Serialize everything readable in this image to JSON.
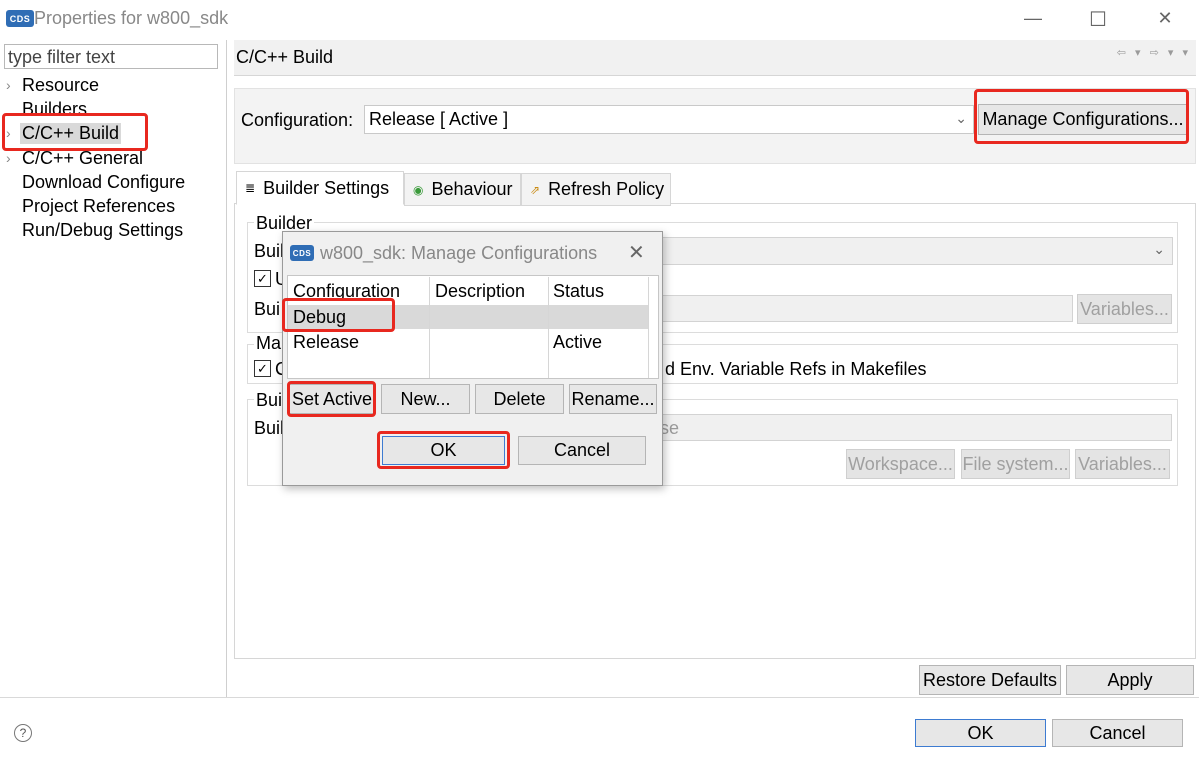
{
  "window": {
    "title": "Properties for w800_sdk",
    "app_badge": "CDS",
    "minimize": "—",
    "maximize": "☐",
    "close": "✕"
  },
  "sidebar": {
    "filter_placeholder": "type filter text",
    "items": [
      {
        "label": "Resource",
        "arrow": "›"
      },
      {
        "label": "Builders",
        "arrow": ""
      },
      {
        "label": "C/C++ Build",
        "arrow": "›"
      },
      {
        "label": "C/C++ General",
        "arrow": "›"
      },
      {
        "label": "Download Configure",
        "arrow": ""
      },
      {
        "label": "Project References",
        "arrow": ""
      },
      {
        "label": "Run/Debug Settings",
        "arrow": ""
      }
    ],
    "selected_index": 2
  },
  "page": {
    "title": "C/C++ Build",
    "nav_arrows": "⇦ ▾ ⇨ ▾ ▾",
    "configuration_label": "Configuration:",
    "configuration_value": "Release  [ Active ]",
    "manage_button": "Manage Configurations...",
    "tabs": [
      {
        "label": "Builder Settings",
        "icon": "≣"
      },
      {
        "label": "Behaviour",
        "icon": "◉"
      },
      {
        "label": "Refresh Policy",
        "icon": "⇗"
      }
    ],
    "builder_group_label": "Builder",
    "builder_type_label": "Buil",
    "use_default_label": "U",
    "build_cmd_label": "Bui",
    "variables_button": "Variables...",
    "makefile_group_label": "Mal",
    "makefile_check_label": "C",
    "makefile_text_tail": "d Env. Variable Refs in Makefiles",
    "build_loc_group_label": "Buil",
    "build_dir_label": "Buil",
    "build_dir_tail": "se",
    "workspace_button": "Workspace...",
    "filesystem_button": "File system...",
    "variables_button_2": "Variables...",
    "restore_defaults": "Restore Defaults",
    "apply": "Apply"
  },
  "footer": {
    "help_icon": "?",
    "ok": "OK",
    "cancel": "Cancel"
  },
  "dialog": {
    "title": "w800_sdk: Manage Configurations",
    "close": "✕",
    "columns": [
      "Configuration",
      "Description",
      "Status"
    ],
    "rows": [
      {
        "configuration": "Debug",
        "description": "",
        "status": ""
      },
      {
        "configuration": "Release",
        "description": "",
        "status": "Active"
      }
    ],
    "set_active": "Set Active",
    "new": "New...",
    "delete": "Delete",
    "rename": "Rename...",
    "ok": "OK",
    "cancel": "Cancel"
  },
  "colors": {
    "highlight_red": "#e8281f",
    "badge_blue": "#2f6db5",
    "selection_gray": "#d9d9d9"
  }
}
